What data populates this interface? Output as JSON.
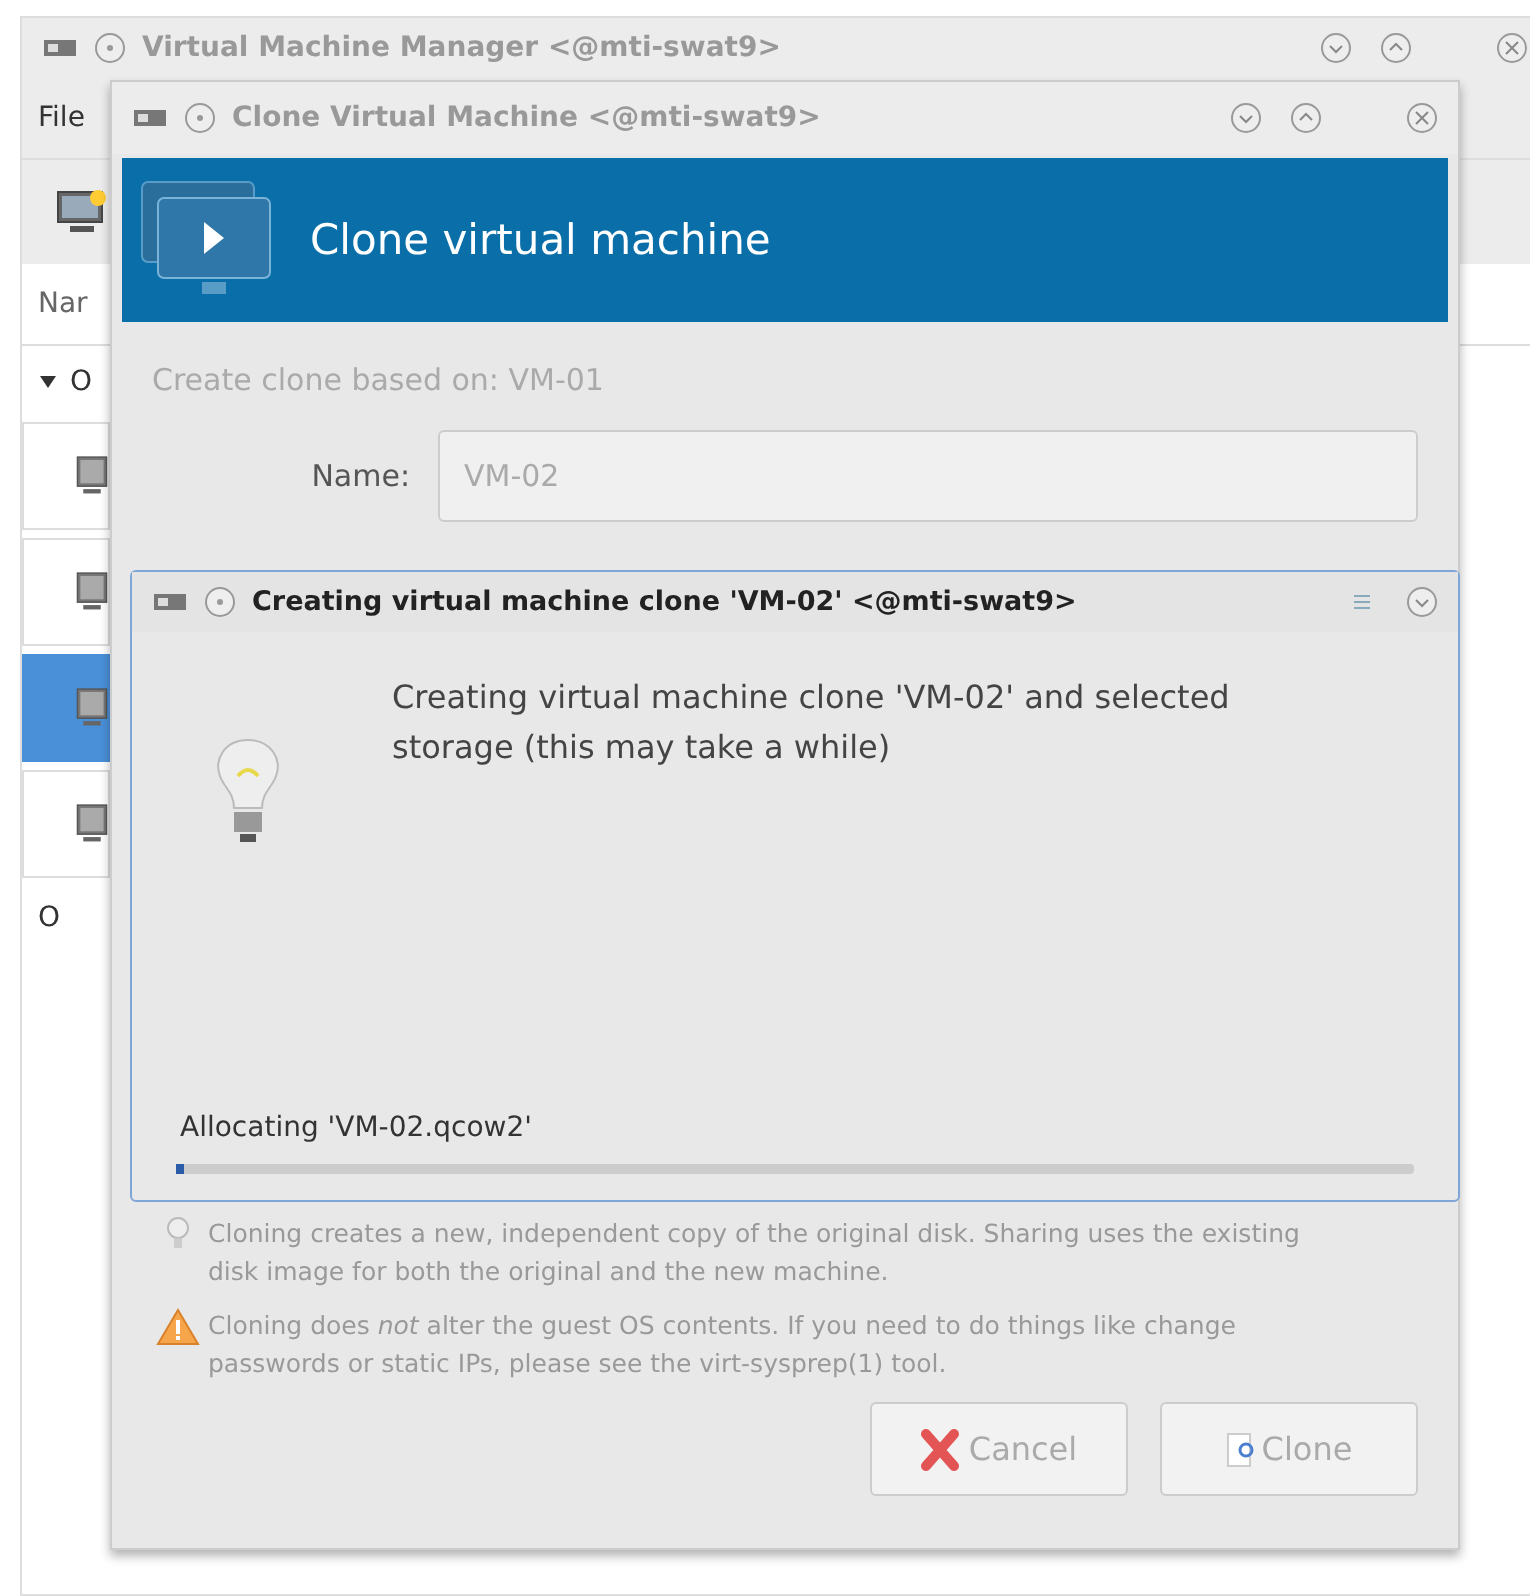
{
  "main_window": {
    "title": "Virtual Machine Manager <@mti-swat9>",
    "active": false,
    "menu": [
      "File"
    ],
    "column_header": "Nar",
    "tree": [
      {
        "label": "O",
        "expanded": true,
        "children": [
          {
            "selected": false
          },
          {
            "selected": false
          },
          {
            "selected": true
          },
          {
            "selected": false
          }
        ]
      },
      {
        "label": "O"
      }
    ]
  },
  "clone_dialog": {
    "title": "Clone Virtual Machine <@mti-swat9>",
    "active": false,
    "header": "Clone virtual machine",
    "based_on": "Create clone based on: VM-01",
    "name_label": "Name:",
    "name_value": "VM-02",
    "notes": [
      {
        "kind": "info",
        "text": "Cloning creates a new, independent copy of the original disk. Sharing uses the existing disk image for both the original and the new machine."
      },
      {
        "kind": "warning",
        "text": "Cloning does *not* alter the guest OS contents. If you need to do things like change passwords or static IPs, please see the virt-sysprep(1) tool."
      }
    ],
    "buttons": [
      {
        "kind": "cancel",
        "label": "Cancel"
      },
      {
        "kind": "clone",
        "label": "Clone"
      }
    ]
  },
  "progress_dialog": {
    "title": "Creating virtual machine clone 'VM-02' <@mti-swat9>",
    "active": true,
    "message": "Creating virtual machine clone 'VM-02' and selected storage (this may take a while)",
    "status": "Allocating 'VM-02.qcow2'",
    "level": 0.006
  }
}
